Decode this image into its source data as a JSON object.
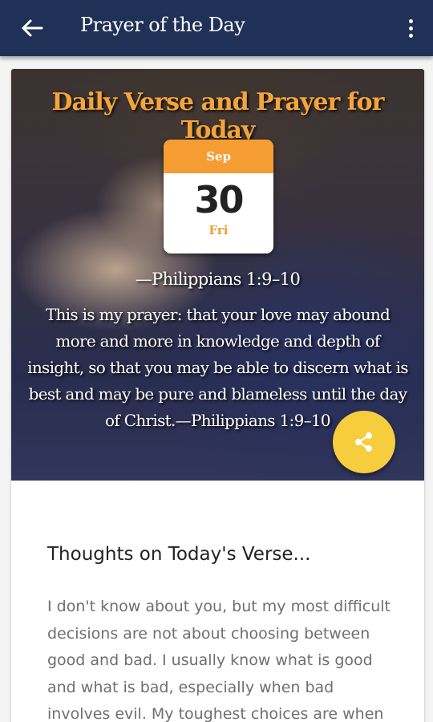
{
  "appbar": {
    "title": "Prayer of the Day",
    "back_icon": "arrow-left-icon",
    "menu_icon": "more-vert-icon",
    "background": "#1f3157"
  },
  "hero": {
    "title": "Daily Verse and Prayer for Today",
    "title_color": "#f4a43a",
    "calendar": {
      "month": "Sep",
      "day": "30",
      "weekday": "Fri",
      "accent": "#f59d32"
    },
    "verse_reference": "—Philippians 1:9–10",
    "verse_text": "This is my prayer: that your love may abound more and more in knowledge and depth of insight, so that you may be able to discern what is best and may be pure and blameless until the day of Christ.—Philippians 1:9–10",
    "share_icon": "share-icon",
    "share_color": "#f6cd3c"
  },
  "thoughts": {
    "title": "Thoughts on Today's Verse...",
    "body": "I don't know about you, but my most difficult decisions are not about choosing between good and bad. I usually know what is good and what is bad, especially when bad involves evil. My toughest choices are when I"
  }
}
